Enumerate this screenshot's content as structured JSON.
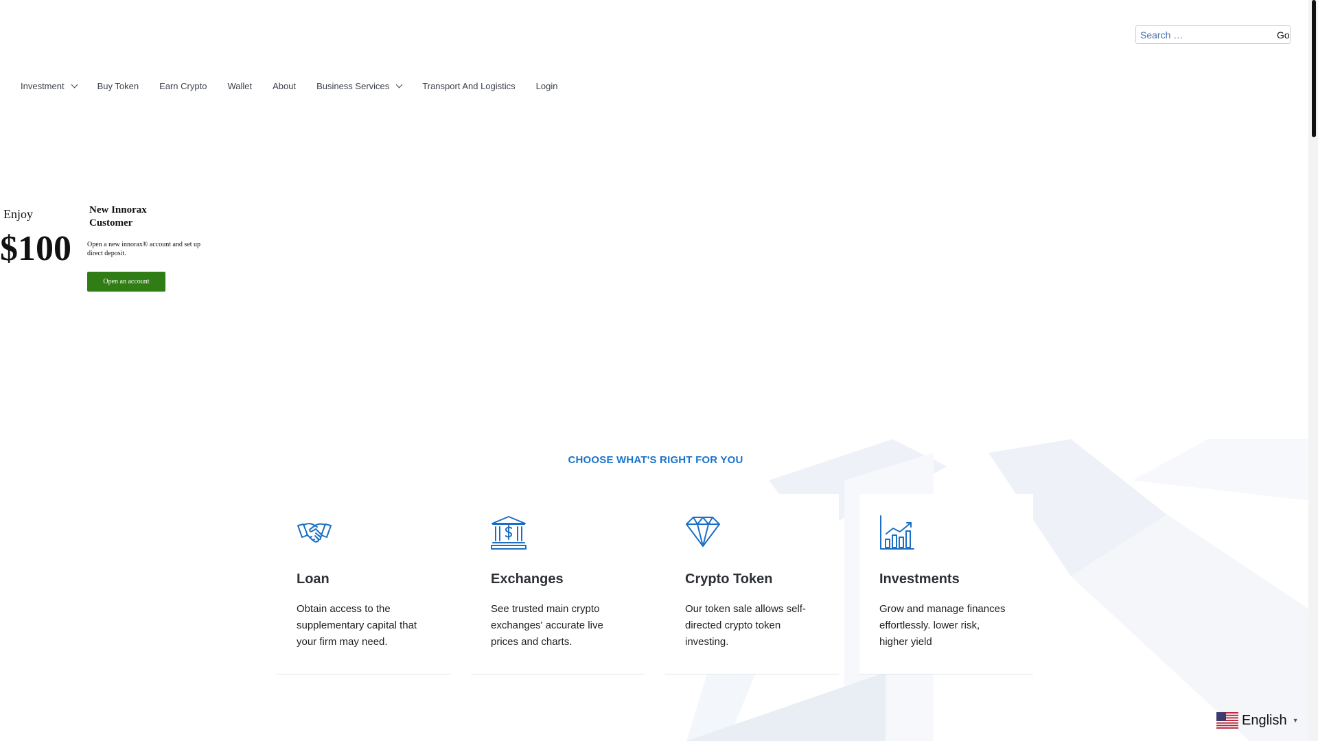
{
  "search": {
    "placeholder": "Search …",
    "button_label": "Go"
  },
  "nav": {
    "items": [
      {
        "label": "Investment",
        "has_dropdown": true
      },
      {
        "label": "Buy Token",
        "has_dropdown": false
      },
      {
        "label": "Earn Crypto",
        "has_dropdown": false
      },
      {
        "label": "Wallet",
        "has_dropdown": false
      },
      {
        "label": "About",
        "has_dropdown": false
      },
      {
        "label": "Business Services",
        "has_dropdown": true
      },
      {
        "label": "Transport And Logistics",
        "has_dropdown": false
      },
      {
        "label": "Login",
        "has_dropdown": false
      }
    ]
  },
  "promo": {
    "enjoy": "Enjoy",
    "amount": "$100",
    "heading": "New Innorax Customer",
    "description": "Open a new innorax® account and set up direct deposit.",
    "button_label": "Open an account",
    "button_color": "#2f7d14"
  },
  "features": {
    "heading": "CHOOSE WHAT'S RIGHT FOR YOU",
    "heading_color": "#1a73c9",
    "icon_color": "#1a6fc4",
    "cards": [
      {
        "icon": "handshake-icon",
        "title": "Loan",
        "text": "Obtain access to the supplementary capital that your firm may need."
      },
      {
        "icon": "bank-icon",
        "title": "Exchanges",
        "text": "See trusted main crypto exchanges' accurate live prices and charts."
      },
      {
        "icon": "diamond-icon",
        "title": "Crypto Token",
        "text": "Our token sale allows self-directed crypto token investing."
      },
      {
        "icon": "bar-chart-icon",
        "title": "Investments",
        "text": "Grow and manage finances effortlessly. lower risk, higher yield"
      }
    ]
  },
  "language": {
    "label": "English",
    "flag": "us-flag-icon"
  }
}
